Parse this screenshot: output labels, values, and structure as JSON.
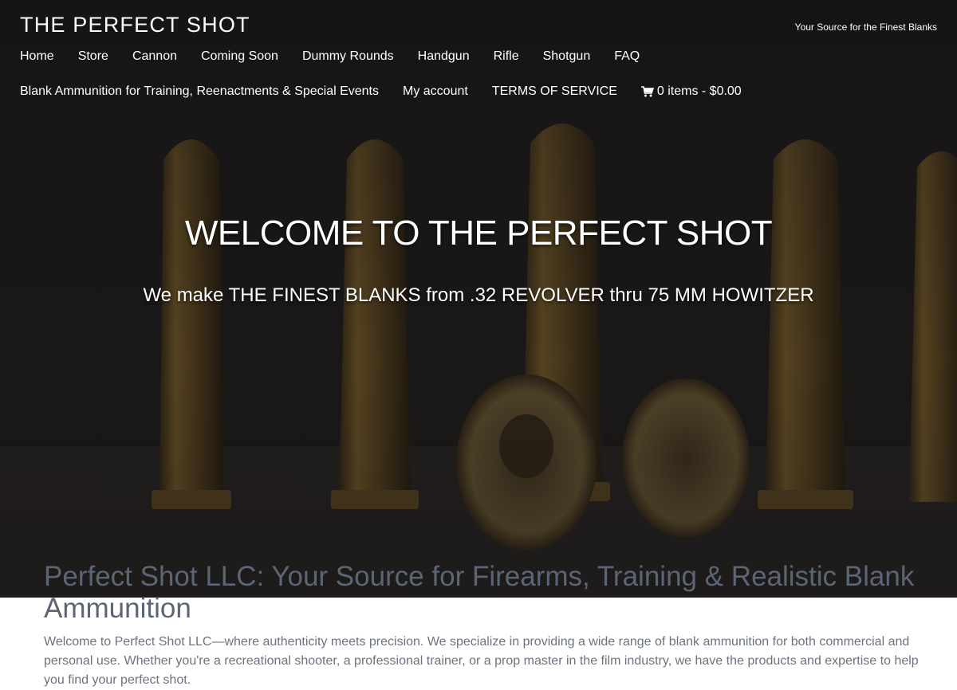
{
  "header": {
    "site_title": "THE PERFECT SHOT",
    "tagline": "Your Source for the Finest Blanks"
  },
  "nav": {
    "row1": [
      {
        "label": "Home"
      },
      {
        "label": "Store"
      },
      {
        "label": "Cannon"
      },
      {
        "label": "Coming Soon"
      },
      {
        "label": "Dummy Rounds"
      },
      {
        "label": "Handgun"
      },
      {
        "label": "Rifle"
      },
      {
        "label": "Shotgun"
      },
      {
        "label": "FAQ"
      }
    ],
    "row2": [
      {
        "label": "Blank Ammunition for Training, Reenactments & Special Events"
      },
      {
        "label": "My account"
      },
      {
        "label": "TERMS OF SERVICE"
      }
    ],
    "cart": {
      "label": "0 items - $0.00",
      "icon": "shopping-cart-icon"
    }
  },
  "hero": {
    "title": "WELCOME TO THE PERFECT SHOT",
    "subtitle": "We make THE FINEST BLANKS from .32 REVOLVER thru 75 MM HOWITZER"
  },
  "content": {
    "title": "Perfect Shot LLC: Your Source for Firearms, Training & Realistic Blank Ammunition",
    "text": "Welcome to Perfect Shot LLC—where authenticity meets precision. We specialize in providing a wide range of blank ammunition for both commercial and personal use. Whether you're a recreational shooter, a professional trainer, or a prop master in the film industry, we have the products and expertise to help you find your perfect shot."
  },
  "colors": {
    "hero_bg": "#1c1919",
    "brass": "#8a6a2c",
    "heading_text": "#5b6574",
    "body_text": "#6b7380"
  }
}
